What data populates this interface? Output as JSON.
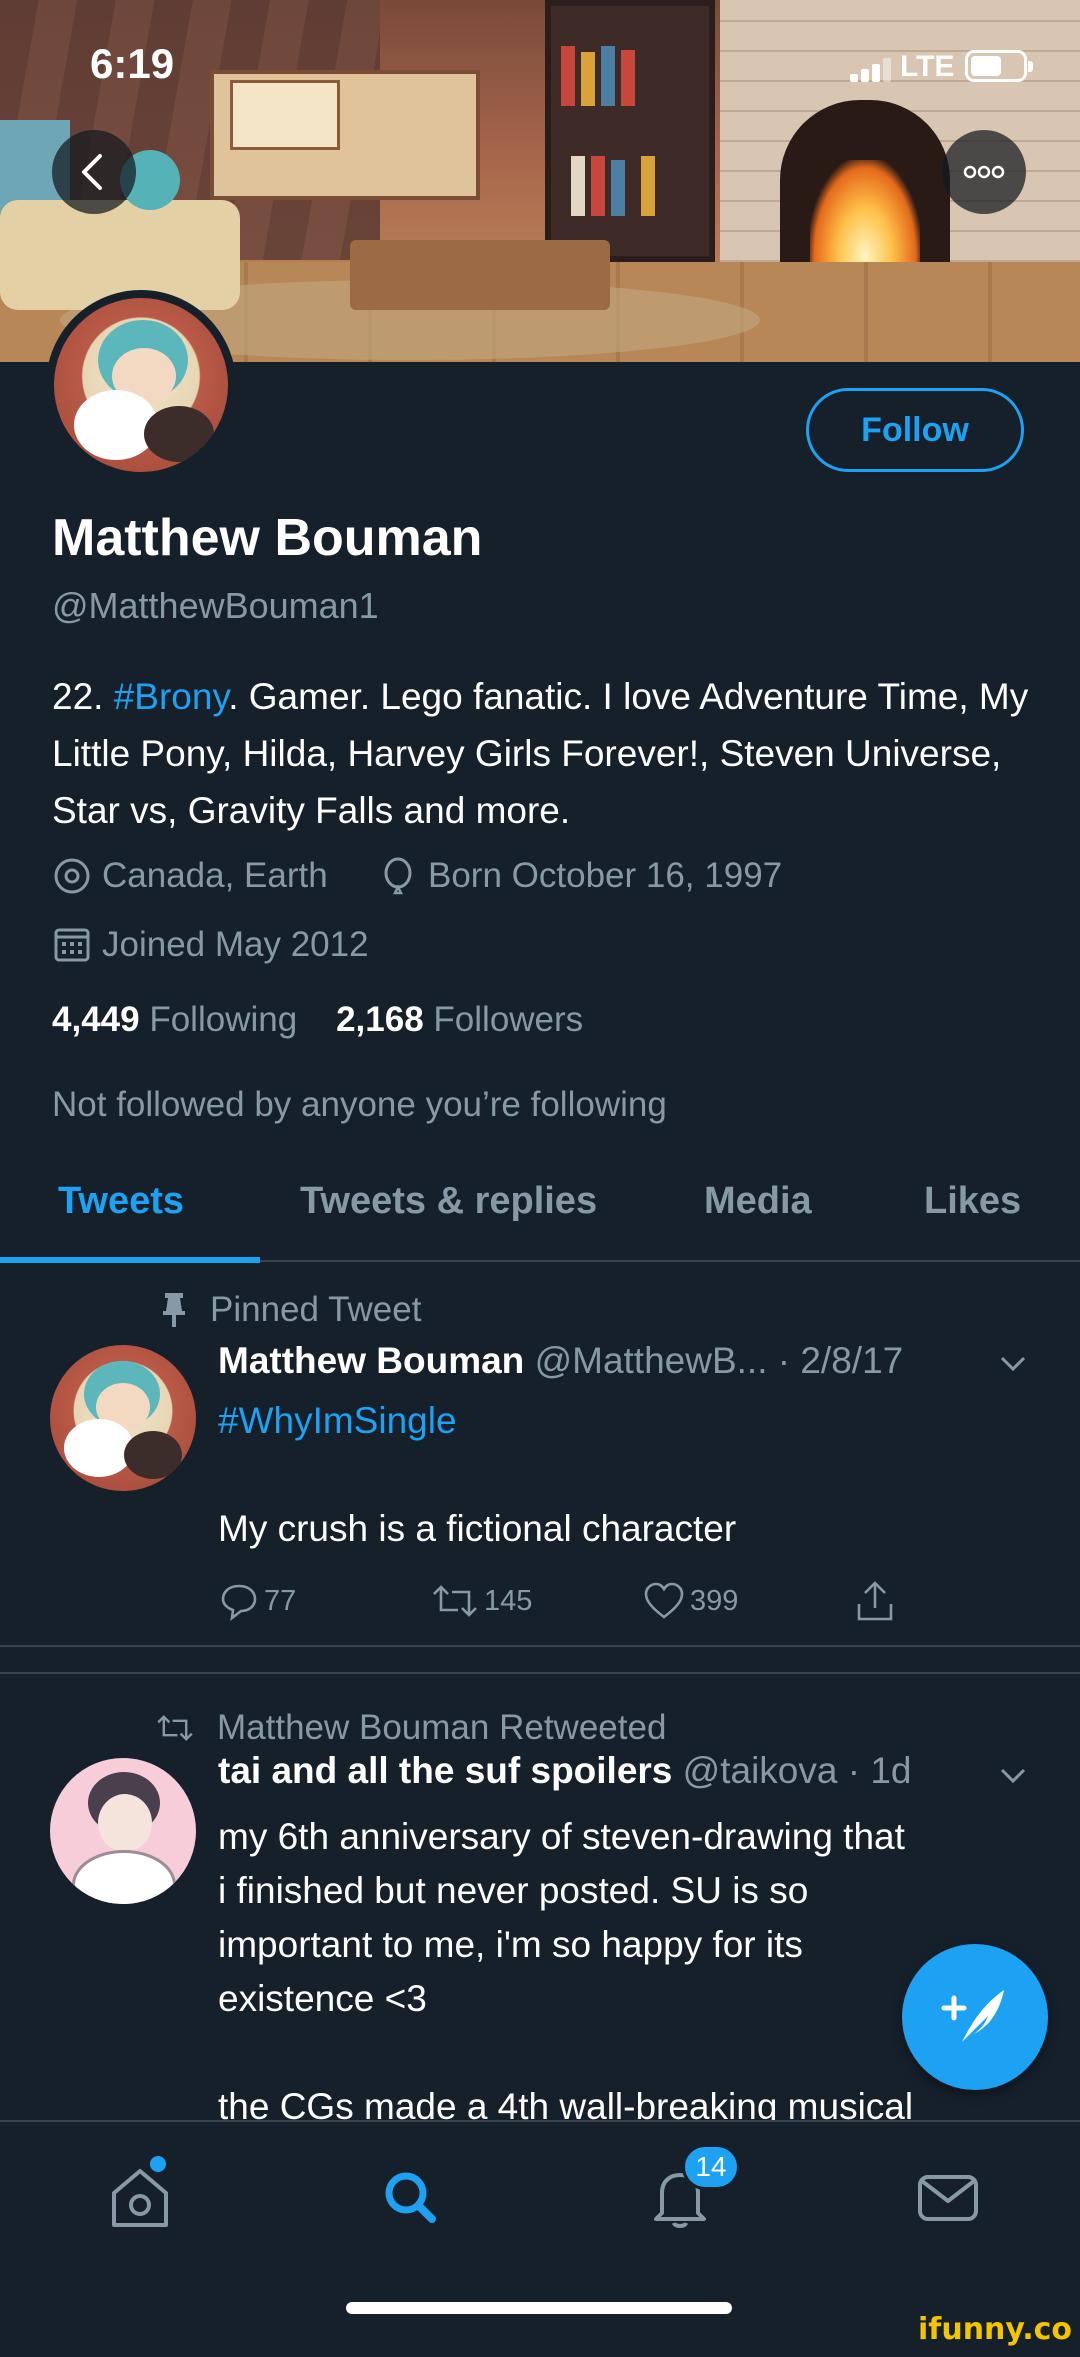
{
  "status_bar": {
    "time": "6:19",
    "network": "LTE"
  },
  "profile": {
    "name": "Matthew Bouman",
    "handle": "@MatthewBouman1",
    "follow_label": "Follow",
    "bio_prefix": "22. ",
    "bio_hashtag": "#Brony",
    "bio_rest": ". Gamer. Lego fanatic. I love Adventure Time, My Little Pony, Hilda, Harvey Girls Forever!, Steven Universe, Star vs, Gravity Falls and more.",
    "location": "Canada, Earth",
    "birthday": "Born October 16, 1997",
    "joined": "Joined May 2012",
    "following_count": "4,449",
    "following_label": "Following",
    "followers_count": "2,168",
    "followers_label": "Followers",
    "not_followed_text": "Not followed by anyone you’re following"
  },
  "tabs": [
    {
      "label": "Tweets",
      "active": true
    },
    {
      "label": "Tweets & replies",
      "active": false
    },
    {
      "label": "Media",
      "active": false
    },
    {
      "label": "Likes",
      "active": false
    }
  ],
  "tweets": [
    {
      "context": "Pinned Tweet",
      "author": "Matthew Bouman",
      "handle_date": "@MatthewB... · 2/8/17",
      "hashtag": "#WhyImSingle",
      "text": "My crush is a fictional character",
      "replies": "77",
      "retweets": "145",
      "likes": "399"
    },
    {
      "context": "Matthew Bouman Retweeted",
      "author": "tai and all the suf spoilers",
      "handle_date": "@taikova · 1d",
      "lines": [
        "my 6th anniversary of steven-drawing that",
        "i finished but never posted. SU is so",
        "important to me, i'm so happy for its",
        "existence <3",
        "the CGs made a 4th wall-breaking musical"
      ]
    }
  ],
  "bottom_nav": {
    "notifications_badge": "14"
  },
  "watermark": "ifunny.co",
  "colors": {
    "background": "#15202b",
    "accent": "#1da1f2",
    "secondary_text": "#8899a6",
    "divider": "#38444d"
  }
}
